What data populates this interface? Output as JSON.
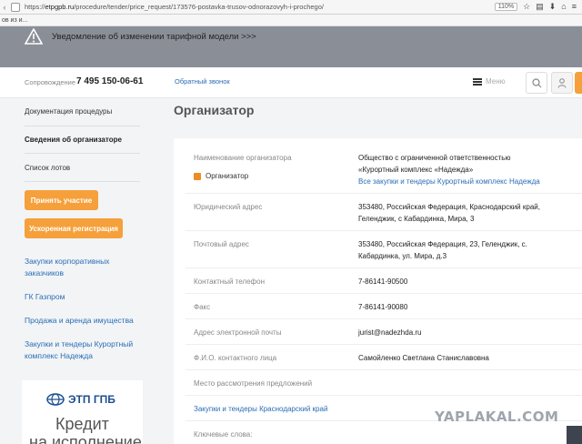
{
  "browser": {
    "url_prefix": "https://",
    "url_host": "etpgpb.ru",
    "url_path": "/procedure/tender/price_request/173576-postavka-trusov-odnorazovyh-i-prochego/",
    "zoom": "110%",
    "bookmark_text": "ов из и..."
  },
  "notice": {
    "text": "Уведомление об изменении тарифной модели >>>"
  },
  "header": {
    "support_label": "Сопровождение",
    "phone": "7 495 150-06-61",
    "callback": "Обратный звонок",
    "menu": "Меню"
  },
  "sidebar": {
    "items": [
      {
        "label": "Документация процедуры"
      },
      {
        "label": "Сведения об организаторе"
      },
      {
        "label": "Список лотов"
      }
    ],
    "buttons": {
      "participate": "Принять участие",
      "express_reg": "Ускоренная регистрация"
    },
    "links": [
      {
        "label": "Закупки корпоративных заказчиков"
      },
      {
        "label": "ГК Газпром"
      },
      {
        "label": "Продажа и аренда имущества"
      },
      {
        "label": "Закупки и тендеры Курортный комплекс Надежда"
      }
    ],
    "banner": {
      "logo": "ЭТП ГПБ",
      "line1": "Кредит",
      "line2": "на исполнение"
    }
  },
  "main": {
    "title": "Организатор",
    "org_name_label": "Наименование организатора",
    "org_name_value_1": "Общество с ограниченной ответственностью",
    "org_name_value_2": "«Курортный комплекс «Надежда»",
    "org_link": "Все закупки и тендеры Курортный комплекс Надежда",
    "organizer_checkbox": "Организатор",
    "legal_address_label": "Юридический адрес",
    "legal_address_1": "353480, Российская Федерация, Краснодарский край,",
    "legal_address_2": "Геленджик, с Кабардинка, Мира, 3",
    "postal_address_label": "Почтовый адрес",
    "postal_address_1": "353480, Российская Федерация, 23, Геленджик, с.",
    "postal_address_2": "Кабардинка, ул. Мира, д.3",
    "phone_label": "Контактный телефон",
    "phone_value": "7-86141-90500",
    "fax_label": "Факс",
    "fax_value": "7-86141-90080",
    "email_label": "Адрес электронной почты",
    "email_value": "jurist@nadezhda.ru",
    "contact_label": "Ф.И.О. контактного лица",
    "contact_value": "Самойленко Светлана Станиславовна",
    "review_place_label": "Место рассмотрения предложений",
    "region_link": "Закупки и тендеры Краснодарский край",
    "keywords_label": "Ключевые слова:"
  },
  "watermark": "YAPLAKAL.COM",
  "colors": {
    "accent_orange": "#f5a03a",
    "link_blue": "#2a6db5",
    "notice_gray": "#8a8f97"
  }
}
